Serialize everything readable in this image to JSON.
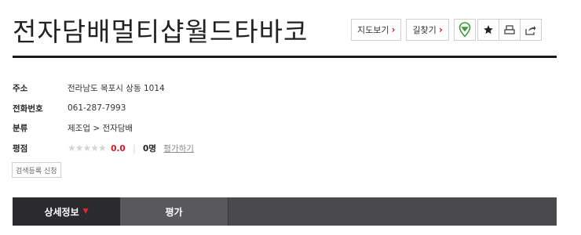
{
  "place": {
    "name": "전자담배멀티샵월드타바코"
  },
  "actions": {
    "map_label": "지도보기",
    "route_label": "길찾기",
    "arrow": "›",
    "pin_icon": "map-pin-icon",
    "bookmark_icon": "star-icon",
    "print_icon": "print-icon",
    "share_icon": "share-icon"
  },
  "info": {
    "address_label": "주소",
    "address": "전라남도 목포시 상동 1014",
    "phone_label": "전화번호",
    "phone": "061-287-7993",
    "category_label": "분류",
    "category": "제조업 > 전자담배",
    "rating_label": "평점",
    "stars": "★★★★★",
    "score": "0.0",
    "separator": "|",
    "review_count": "0명",
    "rate_link": "평가하기"
  },
  "report_button": "검색등록 신청",
  "tabs": {
    "detail": "상세정보",
    "detail_caret": "▼",
    "review": "평가"
  },
  "colors": {
    "accent": "#d8161f",
    "tab_bar": "#4a4a4c",
    "tab_active": "#2b2b2d"
  }
}
